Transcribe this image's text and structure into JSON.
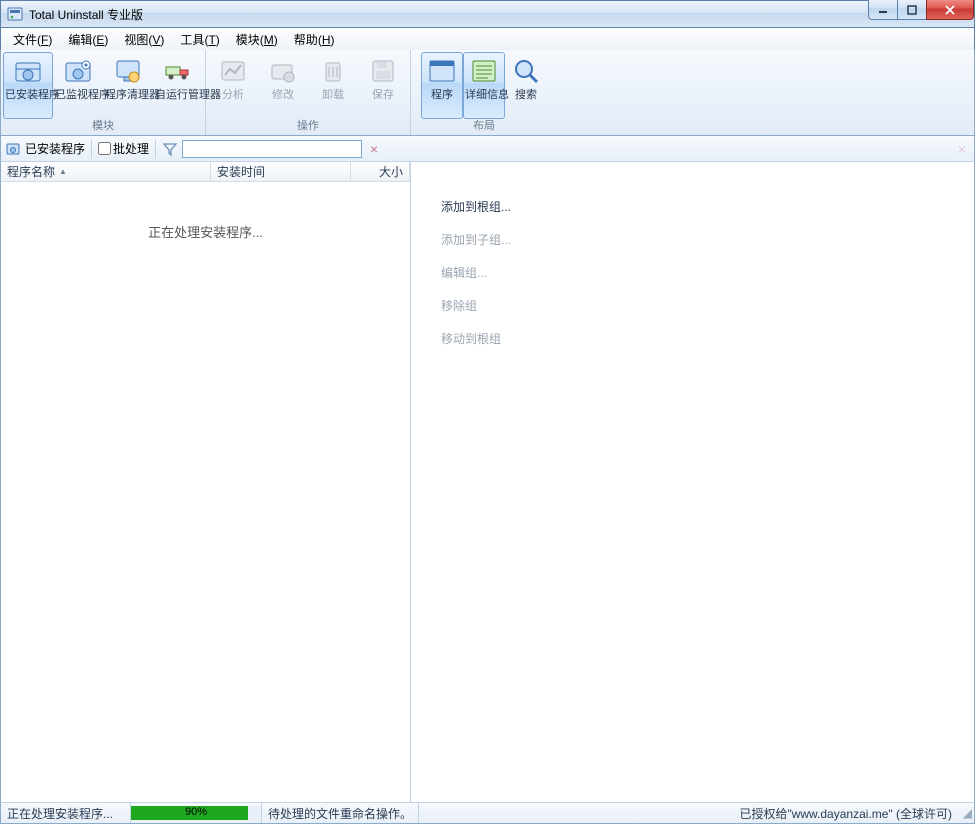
{
  "window": {
    "title": "Total Uninstall 专业版"
  },
  "menu": {
    "file": {
      "label": "文件",
      "accel": "F"
    },
    "edit": {
      "label": "编辑",
      "accel": "E"
    },
    "view": {
      "label": "视图",
      "accel": "V"
    },
    "tools": {
      "label": "工具",
      "accel": "T"
    },
    "modules": {
      "label": "模块",
      "accel": "M"
    },
    "help": {
      "label": "帮助",
      "accel": "H"
    }
  },
  "ribbon": {
    "groups": {
      "module": {
        "label": "模块"
      },
      "actions": {
        "label": "操作"
      },
      "layout": {
        "label": "布局"
      }
    },
    "btn": {
      "installed": "已安装程序",
      "monitored": "已监视程序",
      "cleaner": "程序清理器",
      "autorun": "自运行管理器",
      "analyze": "分析",
      "modify": "修改",
      "uninstall": "卸载",
      "save": "保存",
      "program": "程序",
      "details": "详细信息",
      "search": "搜索"
    }
  },
  "quickbar": {
    "installed_label": "已安装程序",
    "batch_label": "批处理",
    "search_value": ""
  },
  "columns": {
    "name": "程序名称",
    "install_time": "安装时间",
    "size": "大小"
  },
  "leftpane": {
    "loading_text": "正在处理安装程序..."
  },
  "context": {
    "add_root": "添加到根组...",
    "add_child": "添加到子组...",
    "edit_group": "编辑组...",
    "remove_group": "移除组",
    "move_root": "移动到根组"
  },
  "status": {
    "processing": "正在处理安装程序...",
    "progress_percent": 90,
    "progress_text": "90%",
    "pending": "待处理的文件重命名操作。",
    "license": "已授权给\"www.dayanzai.me\" (全球许可)"
  },
  "colors": {
    "accent": "#1fa81f",
    "frame": "#5a7fa8"
  }
}
